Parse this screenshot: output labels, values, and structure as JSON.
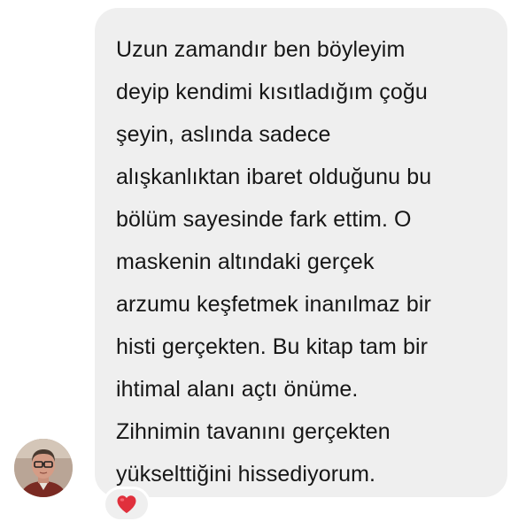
{
  "message": {
    "lines": [
      "Uzun zamandır ben böyleyim",
      "deyip kendimi kısıtladığım çoğu",
      "şeyin, aslında sadece",
      "alışkanlıktan ibaret olduğunu bu",
      "bölüm sayesinde fark ettim. O",
      "maskenin altındaki gerçek",
      "arzumu keşfetmek inanılmaz bir",
      "histi gerçekten. Bu kitap tam bir",
      "ihtimal alanı açtı önüme.",
      "Zihnimin tavanını gerçekten",
      "yükselttiğini hissediyorum."
    ]
  },
  "sender": {
    "avatar_icon": "person-avatar"
  },
  "reaction": {
    "icon": "red-heart-icon",
    "color": "#e0303c"
  },
  "colors": {
    "bubble": "#efefef",
    "text": "#161616"
  }
}
